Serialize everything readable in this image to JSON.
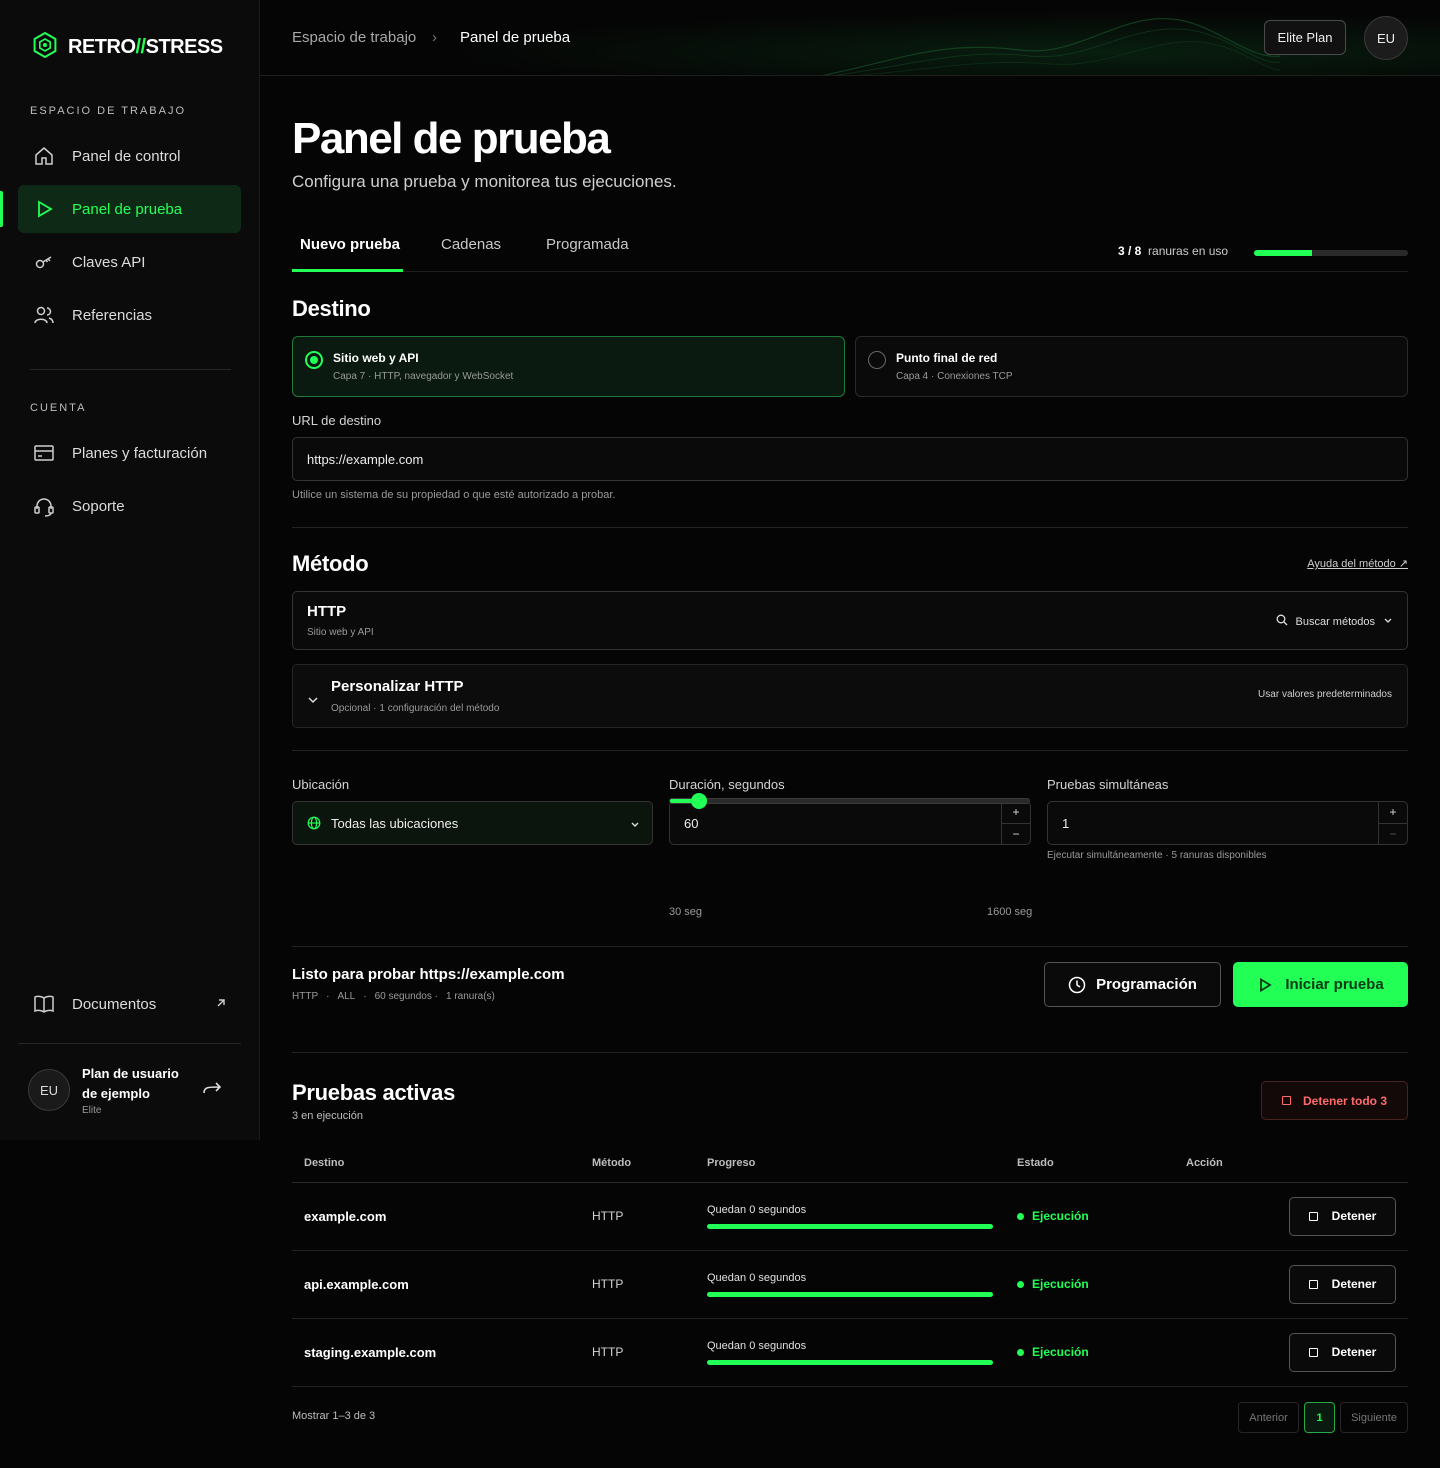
{
  "brand": {
    "name_a": "RETRO",
    "slash": "//",
    "name_b": "STRESS"
  },
  "sidebar": {
    "workspace_label": "ESPACIO DE TRABAJO",
    "items": [
      {
        "label": "Panel de control",
        "icon": "home-icon"
      },
      {
        "label": "Panel de prueba",
        "icon": "play-icon",
        "active": true
      },
      {
        "label": "Claves API",
        "icon": "key-icon"
      },
      {
        "label": "Referencias",
        "icon": "users-icon"
      }
    ],
    "account_label": "CUENTA",
    "account_items": [
      {
        "label": "Planes y facturación",
        "icon": "billing-icon"
      },
      {
        "label": "Soporte",
        "icon": "headset-icon"
      }
    ],
    "docs_label": "Documentos",
    "user": {
      "initials": "EU",
      "name_line1": "Plan de usuario",
      "name_line2": "de ejemplo",
      "plan": "Elite"
    }
  },
  "header": {
    "breadcrumb_root": "Espacio de trabajo",
    "breadcrumb_current": "Panel de prueba",
    "plan_button": "Elite Plan",
    "avatar_initials": "EU"
  },
  "page": {
    "title": "Panel de prueba",
    "subtitle": "Configura una prueba y monitorea tus ejecuciones.",
    "tabs": [
      "Nuevo prueba",
      "Cadenas",
      "Programada"
    ],
    "slots": {
      "used": "3 / 8",
      "label": "ranuras en uso",
      "fraction": 0.375
    }
  },
  "destino": {
    "heading": "Destino",
    "option_web_title": "Sitio web y API",
    "option_web_sub": "Capa 7 · HTTP, navegador y WebSocket",
    "option_net_title": "Punto final de red",
    "option_net_sub": "Capa 4 · Conexiones TCP",
    "url_label": "URL de destino",
    "url_value": "https://example.com",
    "url_hint": "Utilice un sistema de su propiedad o que esté autorizado a probar."
  },
  "metodo": {
    "heading": "Método",
    "help_link": "Ayuda del método ↗",
    "method_name": "HTTP",
    "method_sub": "Sitio web y API",
    "search_label": "Buscar métodos",
    "custom_title": "Personalizar HTTP",
    "custom_sub": "Opcional · 1 configuración del método",
    "custom_action": "Usar valores predeterminados"
  },
  "config": {
    "location_label": "Ubicación",
    "location_value": "Todas las ubicaciones",
    "duration_label": "Duración, segundos",
    "duration_value": "60",
    "duration_min": "30 seg",
    "duration_max": "1600 seg",
    "slider_fraction": 0.08,
    "concurrent_label": "Pruebas simultáneas",
    "concurrent_value": "1",
    "concurrent_hint": "Ejecutar simultáneamente · 5 ranuras disponibles",
    "stepper_plus": "+",
    "stepper_minus": "−"
  },
  "ready": {
    "title": "Listo para probar https://example.com",
    "meta_method": "HTTP",
    "meta_sep": "·",
    "meta_location": "ALL",
    "meta_duration": "60 segundos ·",
    "meta_slots": "1 ranura(s)",
    "schedule_button": "Programación",
    "start_button": "Iniciar prueba"
  },
  "active": {
    "heading": "Pruebas activas",
    "count": "3 en ejecución",
    "stop_all": "Detener todo 3",
    "columns": [
      "Destino",
      "Método",
      "Progreso",
      "Estado",
      "Acción"
    ],
    "rows": [
      {
        "host": "example.com",
        "method": "HTTP",
        "progress_label": "Quedan 0 segundos",
        "progress": 1,
        "status": "Ejecución",
        "action": "Detener"
      },
      {
        "host": "api.example.com",
        "method": "HTTP",
        "progress_label": "Quedan 0 segundos",
        "progress": 1,
        "status": "Ejecución",
        "action": "Detener"
      },
      {
        "host": "staging.example.com",
        "method": "HTTP",
        "progress_label": "Quedan 0 segundos",
        "progress": 1,
        "status": "Ejecución",
        "action": "Detener"
      }
    ],
    "pagination": {
      "summary": "Mostrar 1–3 de 3",
      "prev": "Anterior",
      "page": "1",
      "next": "Siguiente"
    }
  },
  "colors": {
    "accent": "#22ff55",
    "background": "#050505",
    "danger": "#ff6b6b"
  }
}
